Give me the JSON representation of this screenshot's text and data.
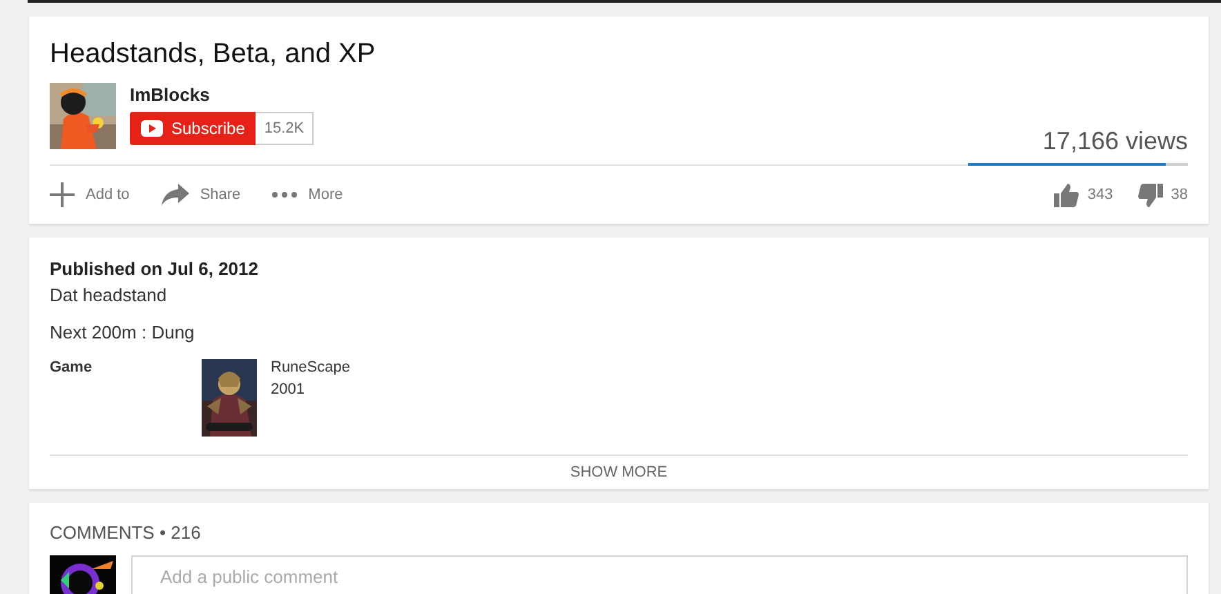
{
  "video": {
    "title": "Headstands, Beta, and XP",
    "channel": "ImBlocks",
    "subscribe_label": "Subscribe",
    "subscriber_count": "15.2K",
    "views": "17,166 views",
    "like_ratio": {
      "level": 0.9
    },
    "actions": [
      {
        "kind": "add",
        "label": "Add to"
      },
      {
        "kind": "share",
        "label": "Share"
      },
      {
        "kind": "more",
        "label": "More"
      }
    ],
    "likes": "343",
    "dislikes": "38"
  },
  "description": {
    "published": "Published on Jul 6, 2012",
    "lines": [
      "Dat headstand",
      "Next 200m : Dung"
    ],
    "meta_label": "Game",
    "game": {
      "name": "RuneScape",
      "year": "2001"
    },
    "show_more": "SHOW MORE"
  },
  "comments": {
    "heading": "COMMENTS • 216",
    "placeholder": "Add a public comment"
  }
}
